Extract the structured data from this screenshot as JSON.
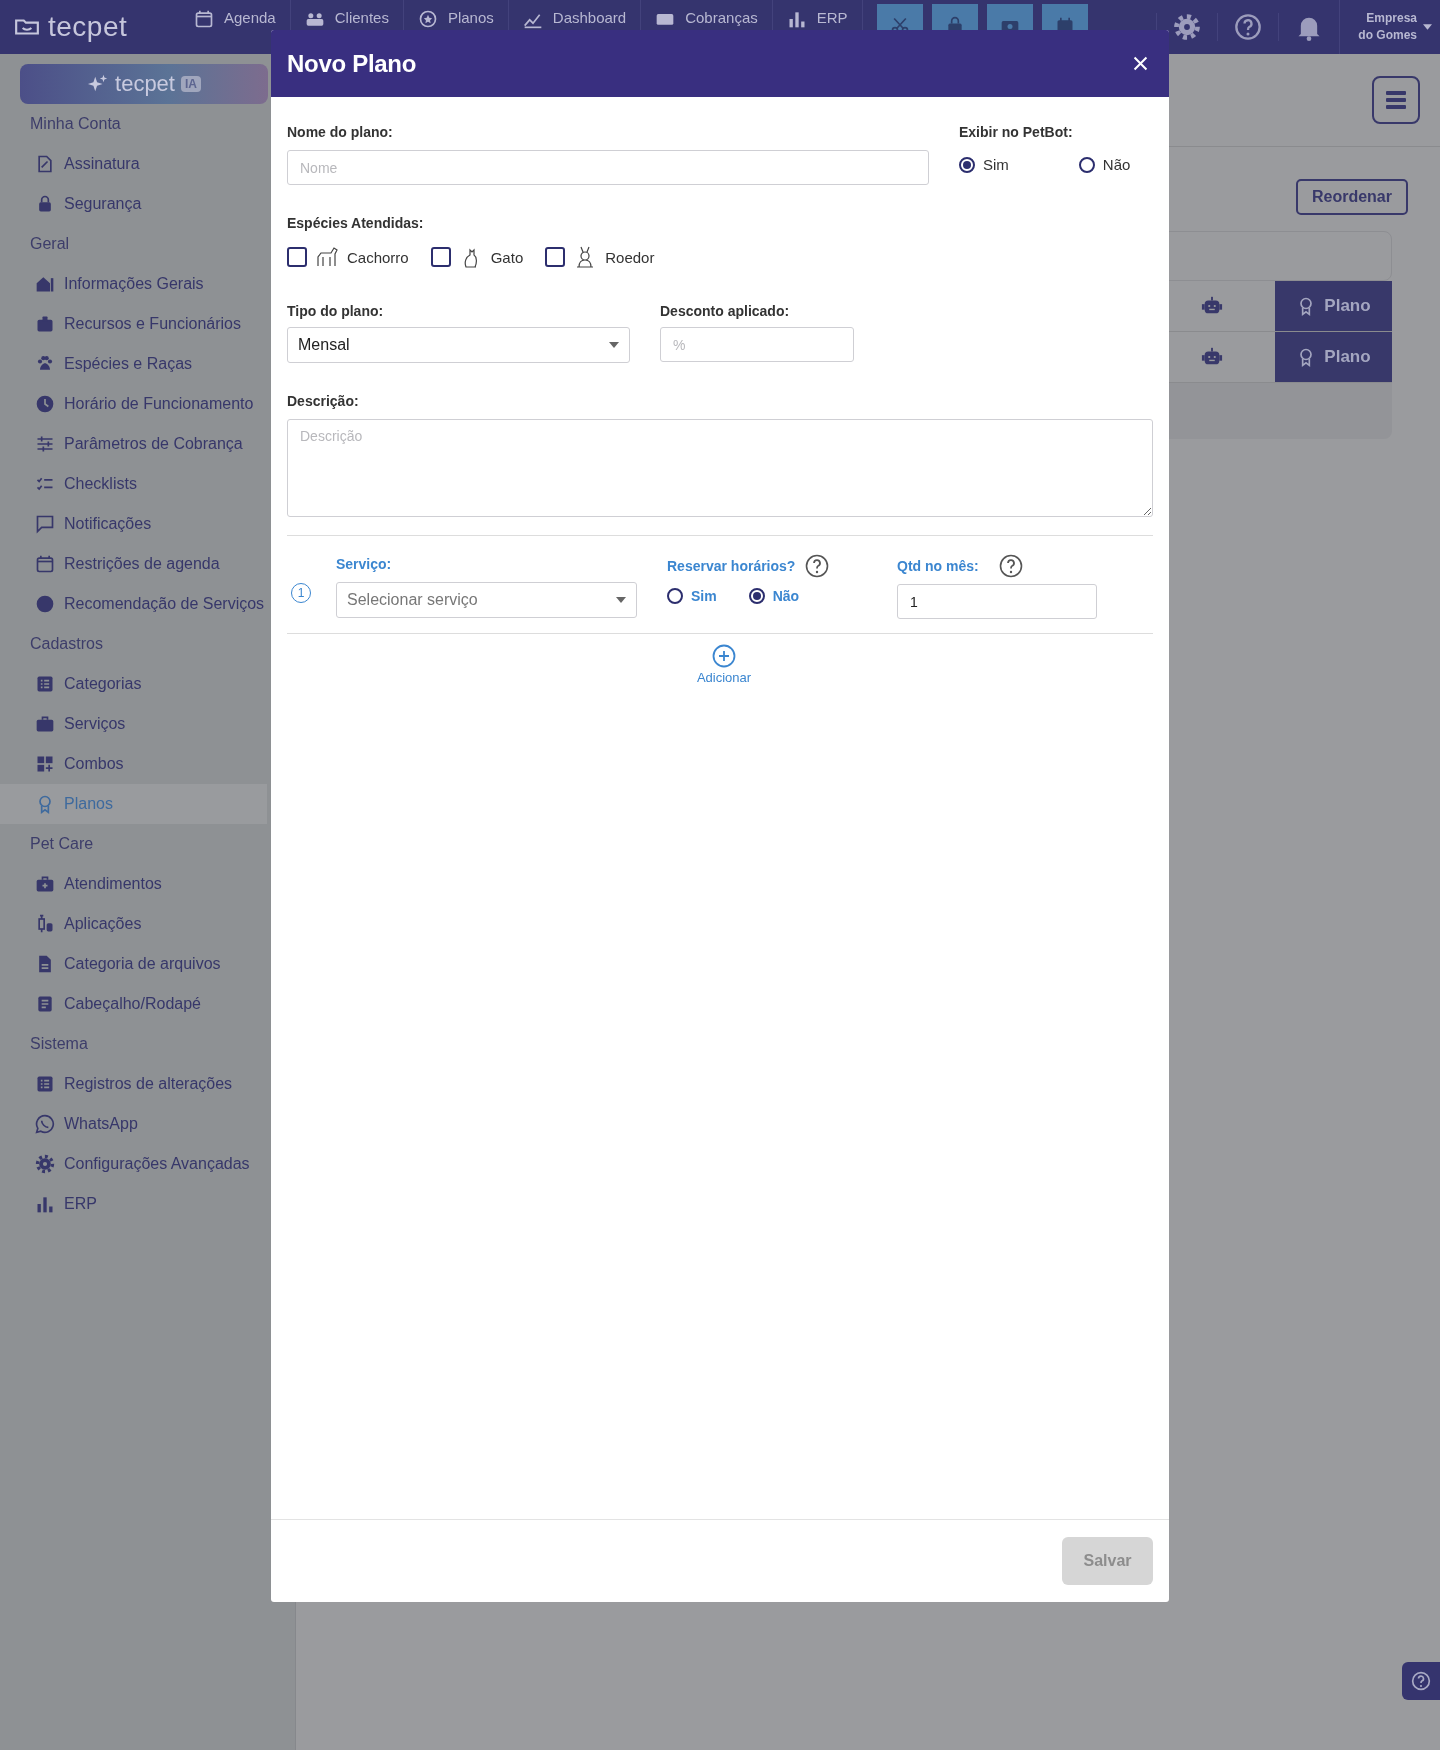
{
  "topbar": {
    "logo": "tecpet",
    "nav": [
      {
        "label": "Agenda",
        "selected": false
      },
      {
        "label": "Clientes",
        "selected": false
      },
      {
        "label": "Planos",
        "selected": false
      },
      {
        "label": "Dashboard",
        "selected": false
      },
      {
        "label": "Cobranças",
        "selected": false
      },
      {
        "label": "ERP",
        "selected": false
      }
    ],
    "company": [
      "Empresa",
      "do Gomes"
    ]
  },
  "sidebar": {
    "ai_button": {
      "logo": "tecpet",
      "badge": "IA"
    },
    "sections": [
      {
        "title": "Minha Conta",
        "items": [
          {
            "label": "Assinatura",
            "selected": false
          },
          {
            "label": "Segurança",
            "selected": false
          }
        ]
      },
      {
        "title": "Geral",
        "items": [
          {
            "label": "Informações Gerais",
            "selected": false
          },
          {
            "label": "Recursos e Funcionários",
            "selected": false
          },
          {
            "label": "Espécies e Raças",
            "selected": false
          },
          {
            "label": "Horário de Funcionamento",
            "selected": false
          },
          {
            "label": "Parâmetros de Cobrança",
            "selected": false
          },
          {
            "label": "Checklists",
            "selected": false
          },
          {
            "label": "Notificações",
            "selected": false
          },
          {
            "label": "Restrições de agenda",
            "selected": false
          },
          {
            "label": "Recomendação de Serviços",
            "selected": false
          }
        ]
      },
      {
        "title": "Cadastros",
        "items": [
          {
            "label": "Categorias",
            "selected": false
          },
          {
            "label": "Serviços",
            "selected": false
          },
          {
            "label": "Combos",
            "selected": false
          },
          {
            "label": "Planos",
            "selected": true
          }
        ]
      },
      {
        "title": "Pet Care",
        "items": [
          {
            "label": "Atendimentos",
            "selected": false
          },
          {
            "label": "Aplicações",
            "selected": false
          },
          {
            "label": "Categoria de arquivos",
            "selected": false
          },
          {
            "label": "Cabeçalho/Rodapé",
            "selected": false
          }
        ]
      },
      {
        "title": "Sistema",
        "items": [
          {
            "label": "Registros de alterações",
            "selected": false
          },
          {
            "label": "WhatsApp",
            "selected": false
          },
          {
            "label": "Configurações Avançadas",
            "selected": false
          },
          {
            "label": "ERP",
            "selected": false
          }
        ]
      }
    ]
  },
  "background": {
    "reorder_button": "Reordenar",
    "rows": [
      {
        "action": "Plano"
      },
      {
        "action": "Plano"
      }
    ]
  },
  "modal": {
    "title": "Novo Plano",
    "name_label": "Nome do plano:",
    "name_placeholder": "Nome",
    "petbot": {
      "label": "Exibir no PetBot:",
      "options": [
        {
          "label": "Sim",
          "selected": true
        },
        {
          "label": "Não",
          "selected": false
        }
      ]
    },
    "species": {
      "label": "Espécies Atendidas:",
      "items": [
        {
          "label": "Cachorro",
          "checked": false
        },
        {
          "label": "Gato",
          "checked": false
        },
        {
          "label": "Roedor",
          "checked": false
        }
      ]
    },
    "type_label": "Tipo do plano:",
    "type_value": "Mensal",
    "discount_label": "Desconto aplicado:",
    "discount_placeholder": "%",
    "description_label": "Descrição:",
    "description_placeholder": "Descrição",
    "services": [
      {
        "number": "1",
        "service_label": "Serviço:",
        "service_placeholder": "Selecionar serviço",
        "reserve_label": "Reservar horários?",
        "reserve_options": [
          {
            "label": "Sim",
            "selected": false
          },
          {
            "label": "Não",
            "selected": true
          }
        ],
        "qty_label": "Qtd no mês:",
        "qty_value": "1"
      }
    ],
    "add_label": "Adicionar",
    "save_button": {
      "label": "Salvar",
      "disabled": true
    }
  }
}
